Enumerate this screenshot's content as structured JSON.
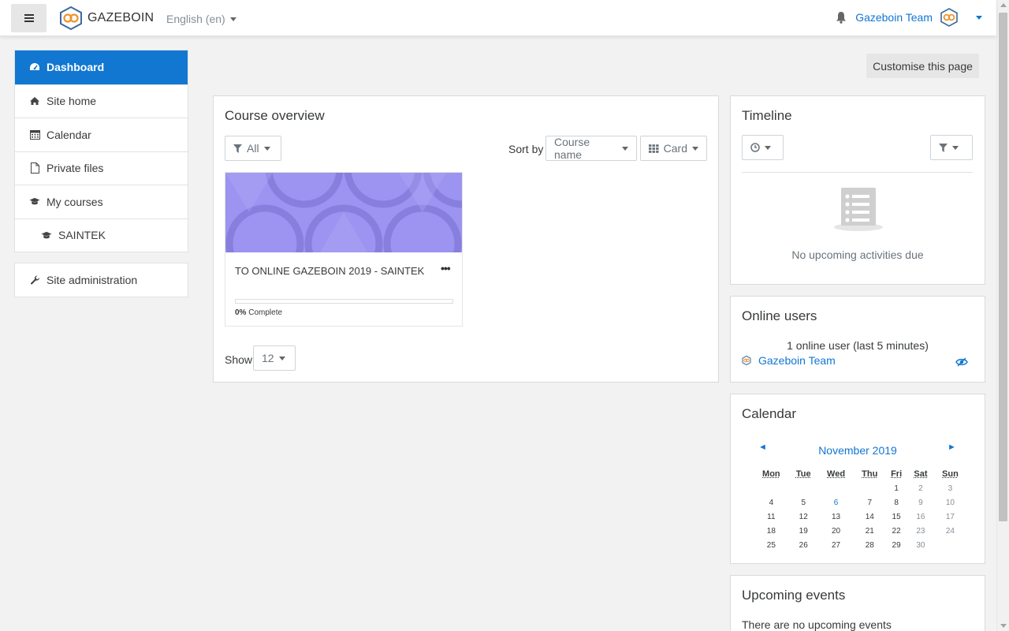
{
  "navbar": {
    "brand": "GAZEBOIN",
    "language": "English (en)",
    "user_name": "Gazeboin Team",
    "icons": [
      "hamburger-icon",
      "logo-icon",
      "bell-icon",
      "avatar-icon"
    ]
  },
  "drawer": {
    "items": [
      {
        "label": "Dashboard",
        "icon": "dashboard-icon",
        "active": true
      },
      {
        "label": "Site home",
        "icon": "home-icon"
      },
      {
        "label": "Calendar",
        "icon": "calendar-icon"
      },
      {
        "label": "Private files",
        "icon": "file-icon"
      },
      {
        "label": "My courses",
        "icon": "graduation-cap-icon"
      },
      {
        "label": "SAINTEK",
        "icon": "graduation-cap-icon"
      }
    ],
    "admin": {
      "label": "Site administration",
      "icon": "wrench-icon"
    }
  },
  "main": {
    "customise_label": "Customise this page",
    "course_overview": {
      "title": "Course overview",
      "filter_label": "All",
      "sort_by_label": "Sort by",
      "sort_value": "Course name",
      "view_value": "Card",
      "course": {
        "name": "TO ONLINE GAZEBOIN 2019 - SAINTEK",
        "menu": "•••",
        "progress_percent": 0,
        "progress_value": "0%",
        "progress_suffix": "Complete"
      },
      "show_label": "Show",
      "show_value": "12"
    },
    "timeline": {
      "title": "Timeline",
      "empty_text": "No upcoming activities due"
    },
    "online_users": {
      "title": "Online users",
      "count_text": "1 online user (last 5 minutes)",
      "users": [
        "Gazeboin Team"
      ]
    },
    "calendar": {
      "title": "Calendar",
      "prev": "◄",
      "next": "►",
      "month": "November 2019",
      "days": [
        "Mon",
        "Tue",
        "Wed",
        "Thu",
        "Fri",
        "Sat",
        "Sun"
      ],
      "weeks": [
        [
          "",
          "",
          "",
          "",
          "1",
          "2",
          "3"
        ],
        [
          "4",
          "5",
          "6",
          "7",
          "8",
          "9",
          "10"
        ],
        [
          "11",
          "12",
          "13",
          "14",
          "15",
          "16",
          "17"
        ],
        [
          "18",
          "19",
          "20",
          "21",
          "22",
          "23",
          "24"
        ],
        [
          "25",
          "26",
          "27",
          "28",
          "29",
          "30",
          ""
        ]
      ],
      "event_days": [
        "6"
      ]
    },
    "upcoming_events": {
      "title": "Upcoming events",
      "text": "There are no upcoming events"
    }
  },
  "colors": {
    "primary": "#1177d1",
    "course_image": "#9c94f0"
  }
}
